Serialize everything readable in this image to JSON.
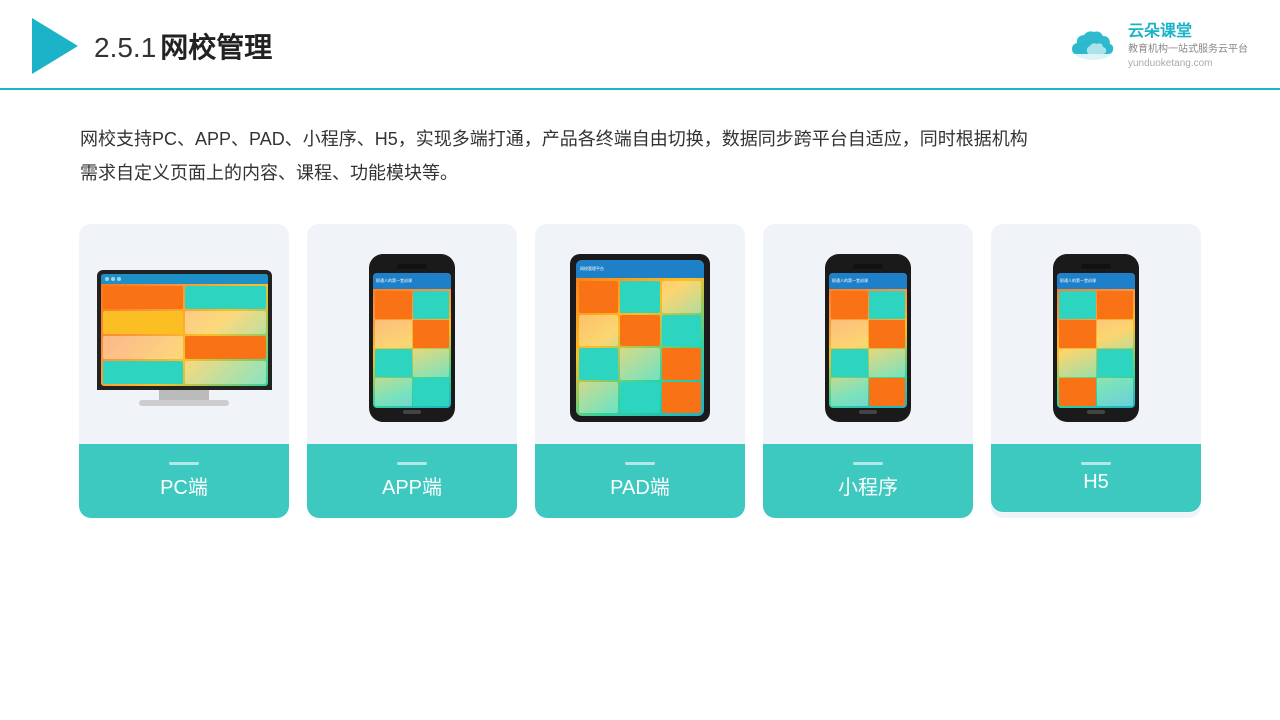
{
  "header": {
    "logo_alt": "play-triangle",
    "title_num": "2.5.1",
    "title_text": "网校管理"
  },
  "brand": {
    "name": "云朵课堂",
    "url": "yunduoketang.com",
    "tagline": "教育机构一站",
    "tagline2": "式服务云平台"
  },
  "description": "网校支持PC、APP、PAD、小程序、H5，实现多端打通，产品各终端自由切换，数据同步跨平台自适应，同时根据机构\n需求自定义页面上的内容、课程、功能模块等。",
  "cards": [
    {
      "id": "pc",
      "label": "PC端"
    },
    {
      "id": "app",
      "label": "APP端"
    },
    {
      "id": "pad",
      "label": "PAD端"
    },
    {
      "id": "miniapp",
      "label": "小程序"
    },
    {
      "id": "h5",
      "label": "H5"
    }
  ],
  "accent_color": "#3dc8c0"
}
